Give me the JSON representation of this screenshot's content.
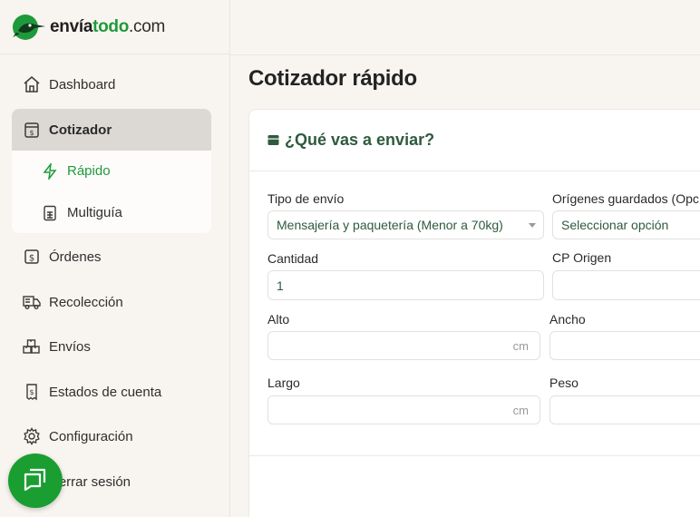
{
  "brand": {
    "name_main": "envía",
    "name_accent": "todo",
    "name_tail": ".com"
  },
  "sidebar": {
    "items": [
      {
        "label": "Dashboard",
        "icon": "home-icon"
      },
      {
        "label": "Cotizador",
        "icon": "quote-icon"
      },
      {
        "label": "Órdenes",
        "icon": "orders-icon"
      },
      {
        "label": "Recolección",
        "icon": "truck-icon"
      },
      {
        "label": "Envíos",
        "icon": "boxes-icon"
      },
      {
        "label": "Estados de cuenta",
        "icon": "statement-icon"
      },
      {
        "label": "Configuración",
        "icon": "gear-icon"
      },
      {
        "label": "Cerrar sesión",
        "icon": "logout-icon"
      }
    ],
    "submenu": [
      {
        "label": "Rápido",
        "icon": "bolt-icon"
      },
      {
        "label": "Multiguía",
        "icon": "sheet-icon"
      }
    ]
  },
  "page": {
    "title": "Cotizador rápido"
  },
  "card": {
    "title": "¿Qué vas a enviar?",
    "fields": {
      "tipo_envio": {
        "label": "Tipo de envío",
        "value": "Mensajería y paquetería (Menor a 70kg)"
      },
      "origenes": {
        "label": "Orígenes guardados (Opc",
        "value": "Seleccionar opción"
      },
      "cantidad": {
        "label": "Cantidad",
        "value": "1"
      },
      "cp_origen": {
        "label": "CP Origen",
        "value": ""
      },
      "alto": {
        "label": "Alto",
        "unit": "cm"
      },
      "ancho": {
        "label": "Ancho"
      },
      "largo": {
        "label": "Largo",
        "unit": "cm"
      },
      "peso": {
        "label": "Peso"
      }
    }
  },
  "colors": {
    "brand_green": "#1e9a3c",
    "fab_green": "#1a9e32",
    "title_green": "#2f5a3e"
  }
}
